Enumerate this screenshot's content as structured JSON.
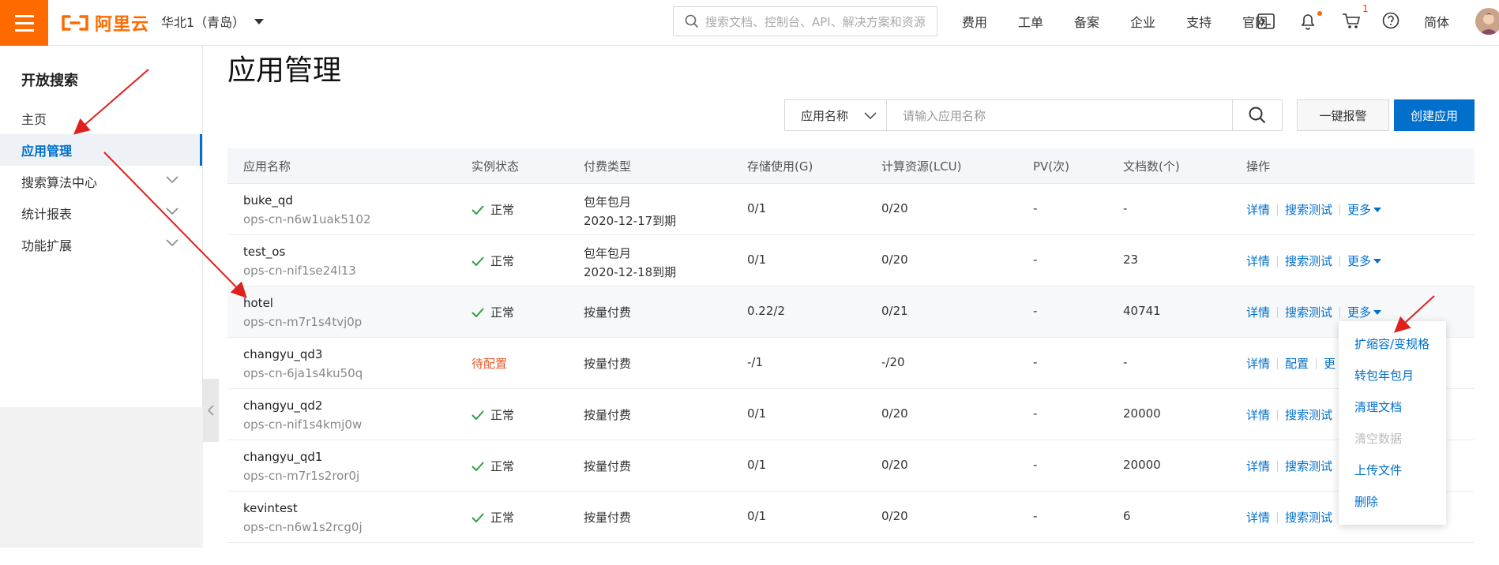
{
  "header": {
    "logo_text": "阿里云",
    "region": "华北1（青岛）",
    "search_placeholder": "搜索文档、控制台、API、解决方案和资源",
    "nav": [
      "费用",
      "工单",
      "备案",
      "企业",
      "支持",
      "官网"
    ],
    "cart_badge": "1",
    "language": "简体",
    "icons": [
      "terminal-icon",
      "bell-icon",
      "cart-icon",
      "help-icon"
    ]
  },
  "sidebar": {
    "title": "开放搜索",
    "items": [
      {
        "label": "主页",
        "active": false,
        "expandable": false
      },
      {
        "label": "应用管理",
        "active": true,
        "expandable": false
      },
      {
        "label": "搜索算法中心",
        "active": false,
        "expandable": true
      },
      {
        "label": "统计报表",
        "active": false,
        "expandable": true
      },
      {
        "label": "功能扩展",
        "active": false,
        "expandable": true
      }
    ]
  },
  "main": {
    "title": "应用管理",
    "filter": {
      "select_value": "应用名称",
      "input_placeholder": "请输入应用名称"
    },
    "alarm_button": "一键报警",
    "create_button": "创建应用",
    "table": {
      "columns": [
        "应用名称",
        "实例状态",
        "付费类型",
        "存储使用(G)",
        "计算资源(LCU)",
        "PV(次)",
        "文档数(个)",
        "操作"
      ],
      "rows": [
        {
          "name": "buke_qd",
          "id": "ops-cn-n6w1uak5102",
          "status": "正常",
          "status_ok": true,
          "pay_1": "包年包月",
          "pay_2": "2020-12-17到期",
          "storage": "0/1",
          "lcu": "0/20",
          "pv": "-",
          "docs": "-",
          "ops": [
            "详情",
            "搜索测试",
            "更多"
          ]
        },
        {
          "name": "test_os",
          "id": "ops-cn-nif1se24l13",
          "status": "正常",
          "status_ok": true,
          "pay_1": "包年包月",
          "pay_2": "2020-12-18到期",
          "storage": "0/1",
          "lcu": "0/20",
          "pv": "-",
          "docs": "23",
          "ops": [
            "详情",
            "搜索测试",
            "更多"
          ]
        },
        {
          "name": "hotel",
          "id": "ops-cn-m7r1s4tvj0p",
          "status": "正常",
          "status_ok": true,
          "pay_1": "按量付费",
          "pay_2": "",
          "storage": "0.22/2",
          "lcu": "0/21",
          "pv": "-",
          "docs": "40741",
          "ops": [
            "详情",
            "搜索测试",
            "更多"
          ]
        },
        {
          "name": "changyu_qd3",
          "id": "ops-cn-6ja1s4ku50q",
          "status": "待配置",
          "status_ok": false,
          "pay_1": "按量付费",
          "pay_2": "",
          "storage": "-/1",
          "lcu": "-/20",
          "pv": "-",
          "docs": "-",
          "ops": [
            "详情",
            "配置",
            "更"
          ]
        },
        {
          "name": "changyu_qd2",
          "id": "ops-cn-nif1s4kmj0w",
          "status": "正常",
          "status_ok": true,
          "pay_1": "按量付费",
          "pay_2": "",
          "storage": "0/1",
          "lcu": "0/20",
          "pv": "-",
          "docs": "20000",
          "ops": [
            "详情",
            "搜索测试"
          ]
        },
        {
          "name": "changyu_qd1",
          "id": "ops-cn-m7r1s2ror0j",
          "status": "正常",
          "status_ok": true,
          "pay_1": "按量付费",
          "pay_2": "",
          "storage": "0/1",
          "lcu": "0/20",
          "pv": "-",
          "docs": "20000",
          "ops": [
            "详情",
            "搜索测试"
          ]
        },
        {
          "name": "kevintest",
          "id": "ops-cn-n6w1s2rcg0j",
          "status": "正常",
          "status_ok": true,
          "pay_1": "按量付费",
          "pay_2": "",
          "storage": "0/1",
          "lcu": "0/20",
          "pv": "-",
          "docs": "6",
          "ops": [
            "详情",
            "搜索测试"
          ]
        }
      ]
    },
    "more_menu": [
      {
        "label": "扩缩容/变规格",
        "disabled": false
      },
      {
        "label": "转包年包月",
        "disabled": false
      },
      {
        "label": "清理文档",
        "disabled": false
      },
      {
        "label": "清空数据",
        "disabled": true
      },
      {
        "label": "上传文件",
        "disabled": false
      },
      {
        "label": "删除",
        "disabled": false
      }
    ]
  },
  "colors": {
    "brand_orange": "#ff6a00",
    "link_blue": "#0070cc",
    "ok_green": "#2e9e49",
    "pending_red": "#e45a2c",
    "annotation_red": "#e0201c"
  }
}
